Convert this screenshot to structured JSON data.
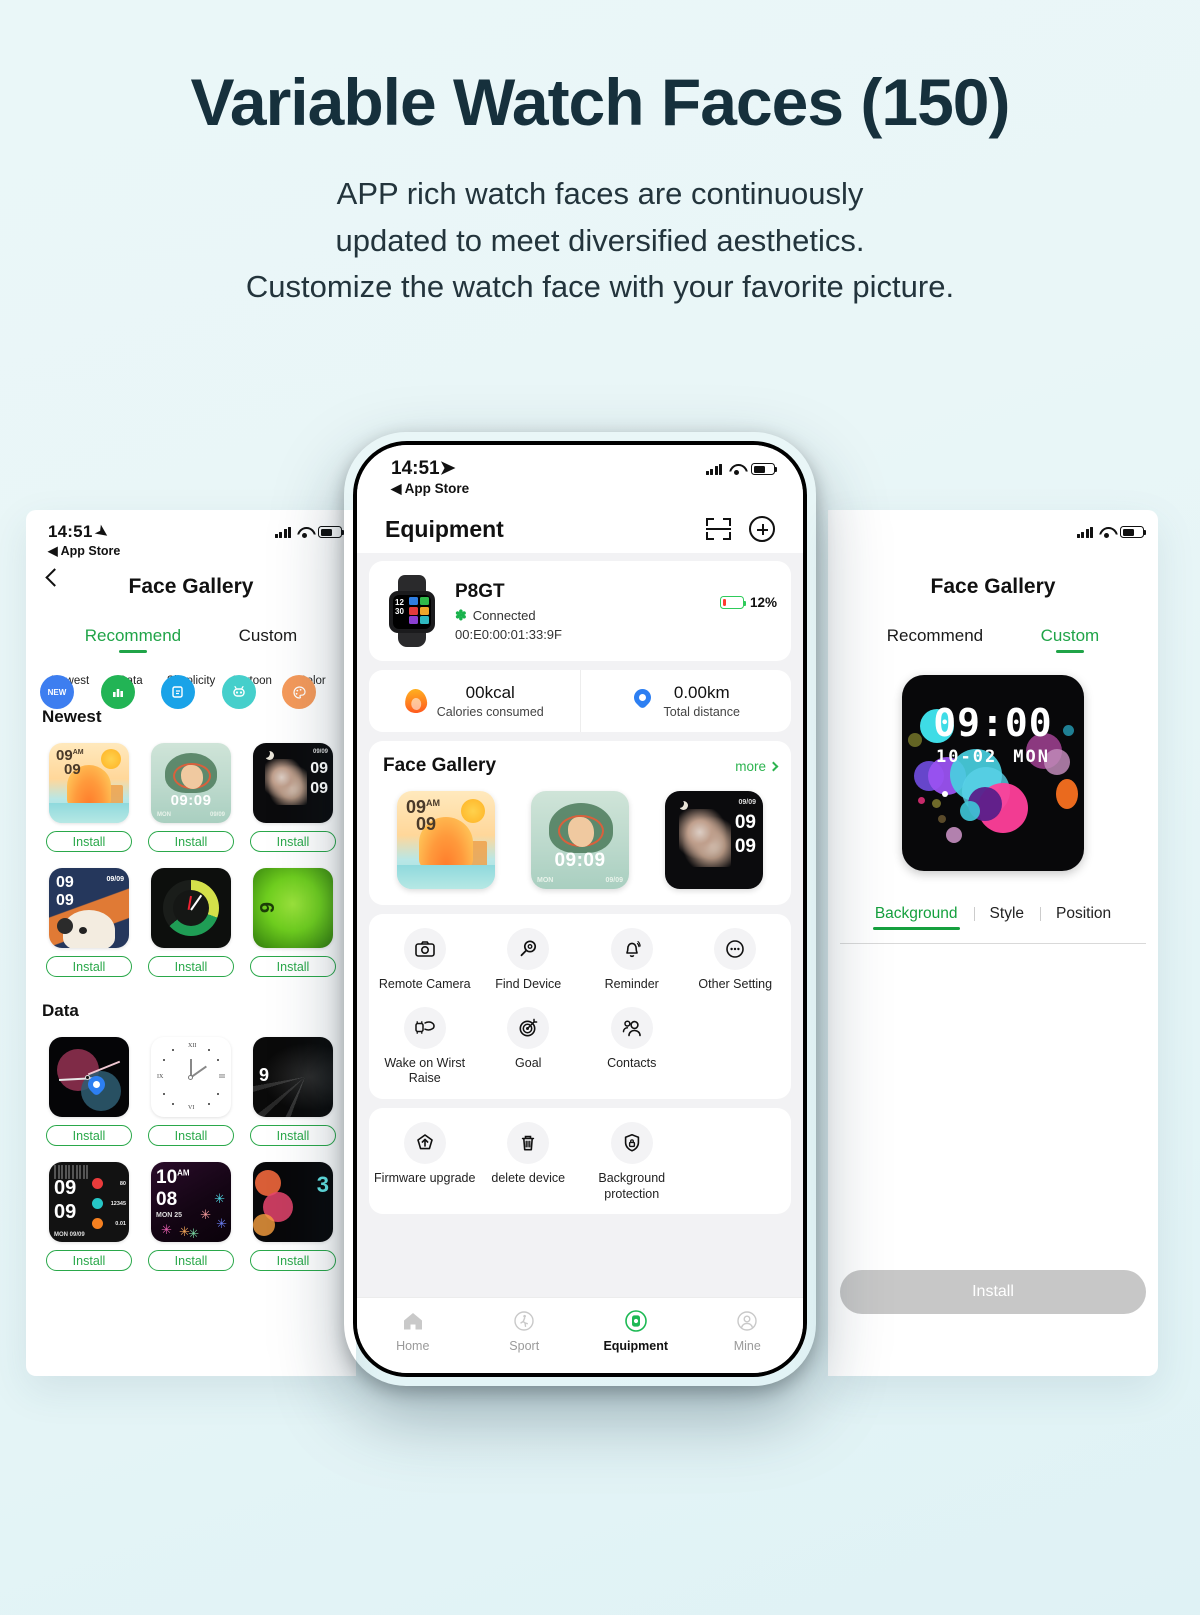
{
  "hero": {
    "title": "Variable Watch Faces (150)",
    "sub_line1": "APP rich watch faces are continuously",
    "sub_line2": "updated to meet diversified aesthetics.",
    "sub_line3": "Customize the watch face with your favorite picture."
  },
  "colors": {
    "accent_green": "#20a448",
    "brand_green": "#2cb34f",
    "page_bg": "#e9f6f7",
    "title_ink": "#16303c"
  },
  "left_phone": {
    "status": {
      "time": "14:51",
      "back_app": "App Store",
      "battery": "62"
    },
    "nav": {
      "title": "Face Gallery",
      "back_icon": "chevron-left-icon"
    },
    "tabs": [
      {
        "label": "Recommend",
        "active": true
      },
      {
        "label": "Custom",
        "active": false
      }
    ],
    "categories": [
      {
        "label": "Newest",
        "badge": "NEW",
        "color": "#3d7ef0",
        "icon": "new-badge-icon"
      },
      {
        "label": "Data",
        "badge": "",
        "color": "#22b455",
        "icon": "bar-chart-icon"
      },
      {
        "label": "Simplicity",
        "badge": "",
        "color": "#1aa3e8",
        "icon": "note-edit-icon"
      },
      {
        "label": "Cartoon",
        "badge": "",
        "color": "#45cfcb",
        "icon": "robot-icon"
      },
      {
        "label": "Color",
        "badge": "",
        "color": "#f59a5b",
        "icon": "palette-icon"
      }
    ],
    "sections": [
      {
        "title": "Newest",
        "faces": [
          {
            "art": "wf-sunrise",
            "install": "Install",
            "time_top": "09",
            "time_ampm": "AM",
            "time_bottom": "09"
          },
          {
            "art": "wf-deer",
            "install": "Install",
            "time": "09:09",
            "weekday": "MON",
            "date": "09/09"
          },
          {
            "art": "wf-night",
            "install": "Install",
            "date": "09/09",
            "h1": "09",
            "h2": "09"
          },
          {
            "art": "wf-dog",
            "install": "Install",
            "h1": "09",
            "h2": "09",
            "date": "09/09"
          },
          {
            "art": "wf-green",
            "install": "Install"
          },
          {
            "art": "wf-limey",
            "install": "Install",
            "digit": "9"
          }
        ]
      },
      {
        "title": "Data",
        "faces": [
          {
            "art": "wf-planets",
            "install": "Install"
          },
          {
            "art": "wf-roman",
            "install": "Install",
            "numerals": [
              "XII",
              "III",
              "VI",
              "IX"
            ]
          },
          {
            "art": "wf-beam",
            "install": "Install",
            "digit": "9"
          },
          {
            "art": "wf-dash",
            "install": "Install",
            "h1": "09",
            "h2": "09",
            "footer": "MON 09/09",
            "stats": [
              {
                "value": "80",
                "color": "#ea3b3b"
              },
              {
                "value": "12345",
                "color": "#26c6c6"
              },
              {
                "value": "0.01",
                "color": "#f58020"
              }
            ]
          },
          {
            "art": "wf-flower",
            "install": "Install",
            "h1": "10",
            "ampm": "AM",
            "h2": "08",
            "sub": "MON 25"
          },
          {
            "art": "wf-bubble",
            "install": "Install",
            "digits": "3"
          }
        ]
      }
    ]
  },
  "center_phone": {
    "status": {
      "time": "14:51",
      "back_app": "App Store",
      "battery": "62"
    },
    "nav": {
      "title": "Equipment",
      "scan_icon": "scan-code-icon",
      "add_icon": "plus-circle-icon"
    },
    "device": {
      "name": "P8GT",
      "connection": "Connected",
      "bluetooth_icon": "bluetooth-icon",
      "mac": "00:E0:00:01:33:9F",
      "battery_pct": "12%",
      "battery_level": 12
    },
    "stats": [
      {
        "icon": "flame-icon",
        "value": "00kcal",
        "label": "Calories consumed"
      },
      {
        "icon": "location-pin-icon",
        "value": "0.00km",
        "label": "Total distance"
      }
    ],
    "gallery": {
      "title": "Face Gallery",
      "more": "more",
      "more_icon": "chevron-right-icon",
      "faces": [
        {
          "art": "wf-sunrise",
          "time_top": "09",
          "time_ampm": "AM",
          "time_bottom": "09"
        },
        {
          "art": "wf-deer",
          "time": "09:09",
          "weekday": "MON",
          "date": "09/09"
        },
        {
          "art": "wf-night",
          "date": "09/09",
          "h1": "09",
          "h2": "09"
        }
      ]
    },
    "features_row1": [
      {
        "label": "Remote Camera",
        "icon": "camera-icon"
      },
      {
        "label": "Find Device",
        "icon": "magnifier-icon"
      },
      {
        "label": "Reminder",
        "icon": "bell-icon"
      },
      {
        "label": "Other Setting",
        "icon": "ellipsis-circle-icon"
      },
      {
        "label": "Wake on Wirst Raise",
        "icon": "wrist-raise-icon"
      },
      {
        "label": "Goal",
        "icon": "target-icon"
      },
      {
        "label": "Contacts",
        "icon": "contacts-icon"
      }
    ],
    "features_row2": [
      {
        "label": "Firmware upgrade",
        "icon": "firmware-upgrade-icon"
      },
      {
        "label": "delete device",
        "icon": "trash-icon"
      },
      {
        "label": "Background protection",
        "icon": "shield-lock-icon"
      }
    ],
    "tabbar": [
      {
        "label": "Home",
        "icon": "home-icon",
        "active": false
      },
      {
        "label": "Sport",
        "icon": "running-icon",
        "active": false
      },
      {
        "label": "Equipment",
        "icon": "watch-icon",
        "active": true
      },
      {
        "label": "Mine",
        "icon": "person-icon",
        "active": false
      }
    ]
  },
  "right_phone": {
    "status": {
      "battery": "62"
    },
    "nav": {
      "title": "Face Gallery"
    },
    "tabs": [
      {
        "label": "Recommend",
        "active": false
      },
      {
        "label": "Custom",
        "active": true
      }
    ],
    "preview": {
      "time": "09:00",
      "date": "10-02",
      "weekday": "MON"
    },
    "segments": [
      {
        "label": "Background",
        "active": true
      },
      {
        "label": "Style",
        "active": false
      },
      {
        "label": "Position",
        "active": false
      }
    ],
    "install_button": "Install"
  }
}
